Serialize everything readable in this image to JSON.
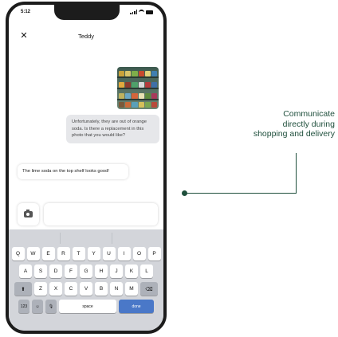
{
  "status_bar": {
    "time": "5:12"
  },
  "header": {
    "title": "Teddy",
    "close_icon": "close-icon"
  },
  "messages": [
    {
      "from": "shopper",
      "type": "image"
    },
    {
      "from": "shopper",
      "type": "text",
      "text": "Unfortunately, they are out of orange soda. Is there a replacement in this photo that you would like?"
    },
    {
      "from": "customer",
      "type": "text",
      "text": "The lime soda on the top shelf looks good!"
    }
  ],
  "composer": {
    "camera_icon": "camera-icon",
    "input_placeholder": ""
  },
  "keyboard": {
    "row1": [
      "Q",
      "W",
      "E",
      "R",
      "T",
      "Y",
      "U",
      "I",
      "O",
      "P"
    ],
    "row2": [
      "A",
      "S",
      "D",
      "F",
      "G",
      "H",
      "J",
      "K",
      "L"
    ],
    "row3": [
      "Z",
      "X",
      "C",
      "V",
      "B",
      "N",
      "M"
    ],
    "numbers_label": "123",
    "space_label": "space",
    "done_label": "done"
  },
  "callout": {
    "lines": [
      "Communicate",
      "directly during",
      "shopping and delivery"
    ],
    "color": "#1f4f3c"
  }
}
